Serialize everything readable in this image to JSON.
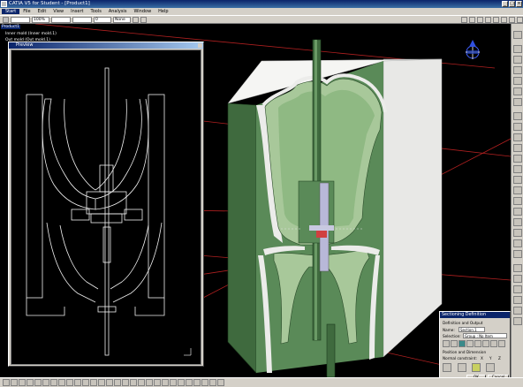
{
  "app": {
    "title": "CATIA V5 for Student - [Product1]"
  },
  "window_buttons": [
    "_",
    "□",
    "×"
  ],
  "menu": [
    {
      "label": "Start",
      "active": true
    },
    {
      "label": "File"
    },
    {
      "label": "Edit"
    },
    {
      "label": "View"
    },
    {
      "label": "Insert"
    },
    {
      "label": "Tools"
    },
    {
      "label": "Analysis"
    },
    {
      "label": "Window"
    },
    {
      "label": "Help"
    }
  ],
  "toolbar": {
    "combo1": "",
    "combo2": "100%",
    "combo3": "",
    "combo4": "",
    "combo5": "0",
    "combo6": "None"
  },
  "tree": {
    "items": [
      {
        "label": "Product1",
        "selected": true
      },
      {
        "label": "Inner mold (Inner mold.1)"
      },
      {
        "label": "Out mold (Out mold.1)"
      },
      {
        "label": "Preview"
      }
    ]
  },
  "preview": {
    "title": "Preview"
  },
  "section_panel": {
    "title": "Sectioning Definition",
    "group1": "Definition and Output",
    "name_label": "Name:",
    "name_value": "Section.1",
    "selection_label": "Selection:",
    "selection_value": "Group : No Item",
    "group2": "Position and Dimension",
    "normal_label": "Normal constraint:",
    "normal_options": [
      "X",
      "Y",
      "Z"
    ],
    "ok": "OK",
    "cancel": "Cancel"
  },
  "colors": {
    "mold_light": "#eeeeee",
    "mold_green": "#a8c89a",
    "mold_dark_green": "#3f6a3e",
    "section_line": "#b02020",
    "title_blue": "#0a246a"
  }
}
